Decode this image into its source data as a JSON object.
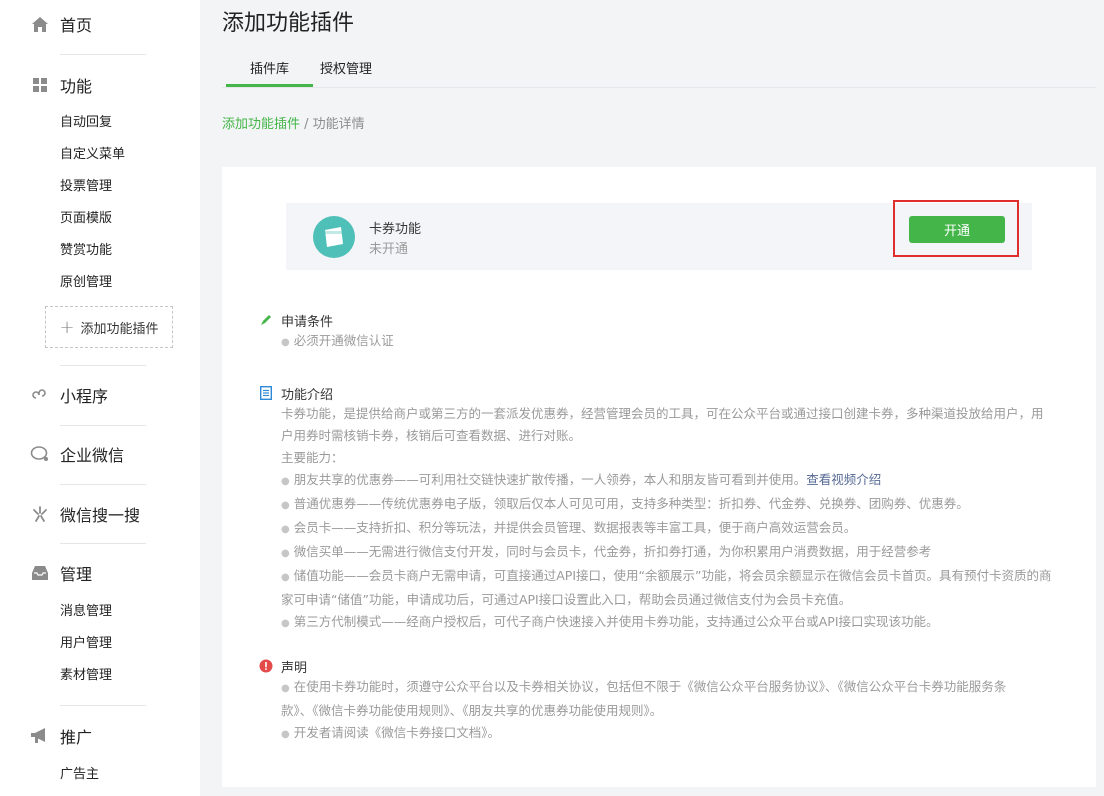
{
  "sidebar": {
    "home": "首页",
    "features": {
      "label": "功能",
      "items": [
        "自动回复",
        "自定义菜单",
        "投票管理",
        "页面模版",
        "赞赏功能",
        "原创管理"
      ],
      "add_plugin": "添加功能插件"
    },
    "miniprogram": "小程序",
    "enterprise_wechat": "企业微信",
    "wechat_search": "微信搜一搜",
    "manage": {
      "label": "管理",
      "items": [
        "消息管理",
        "用户管理",
        "素材管理"
      ]
    },
    "promote": {
      "label": "推广",
      "items": [
        "广告主"
      ]
    }
  },
  "main": {
    "title": "添加功能插件",
    "tabs": [
      "插件库",
      "授权管理"
    ],
    "breadcrumb": {
      "link": "添加功能插件",
      "sep": " / ",
      "current": "功能详情"
    },
    "plugin": {
      "name": "卡券功能",
      "status": "未开通",
      "button": "开通"
    },
    "conditions": {
      "title": "申请条件",
      "items": [
        "必须开通微信认证"
      ]
    },
    "intro": {
      "title": "功能介绍",
      "desc_line1": "卡券功能，是提供给商户或第三方的一套派发优惠券，经营管理会员的工具，可在公众平台或通过接口创建卡券，多种渠道投放给用户，用",
      "desc_line2": "户用券时需核销卡券，核销后可查看数据、进行对账。",
      "abilities_label": "主要能力：",
      "ability1": "朋友共享的优惠券——可利用社交链快速扩散传播，一人领券，本人和朋友皆可看到并使用。",
      "ability1_link": "查看视频介绍",
      "ability2": "普通优惠券——传统优惠券电子版，领取后仅本人可见可用，支持多种类型：折扣券、代金券、兑换券、团购券、优惠券。",
      "ability3": "会员卡——支持折扣、积分等玩法，并提供会员管理、数据报表等丰富工具，便于商户高效运营会员。",
      "ability4": "微信买单——无需进行微信支付开发，同时与会员卡，代金券，折扣券打通，为你积累用户消费数据，用于经营参考",
      "ability5_line1": "储值功能——会员卡商户无需申请，可直接通过API接口，使用“余额展示”功能，将会员余额显示在微信会员卡首页。具有预付卡资质的商",
      "ability5_line2": "家可申请“储值”功能，申请成功后，可通过API接口设置此入口，帮助会员通过微信支付为会员卡充值。",
      "ability6": "第三方代制模式——经商户授权后，可代子商户快速接入并使用卡券功能，支持通过公众平台或API接口实现该功能。"
    },
    "statement": {
      "title": "声明",
      "line1": "在使用卡券功能时，须遵守公众平台以及卡券相关协议，包括但不限于《微信公众平台服务协议》、《微信公众平台卡券功能服务条",
      "line2": "款》、《微信卡券功能使用规则》、《朋友共享的优惠券功能使用规则》。",
      "line3": "开发者请阅读《微信卡券接口文档》。"
    }
  },
  "colors": {
    "accent": "#44b549",
    "highlight": "#e02e2e",
    "plugin_icon": "#4ec0b8",
    "link_blue": "#576b95"
  }
}
